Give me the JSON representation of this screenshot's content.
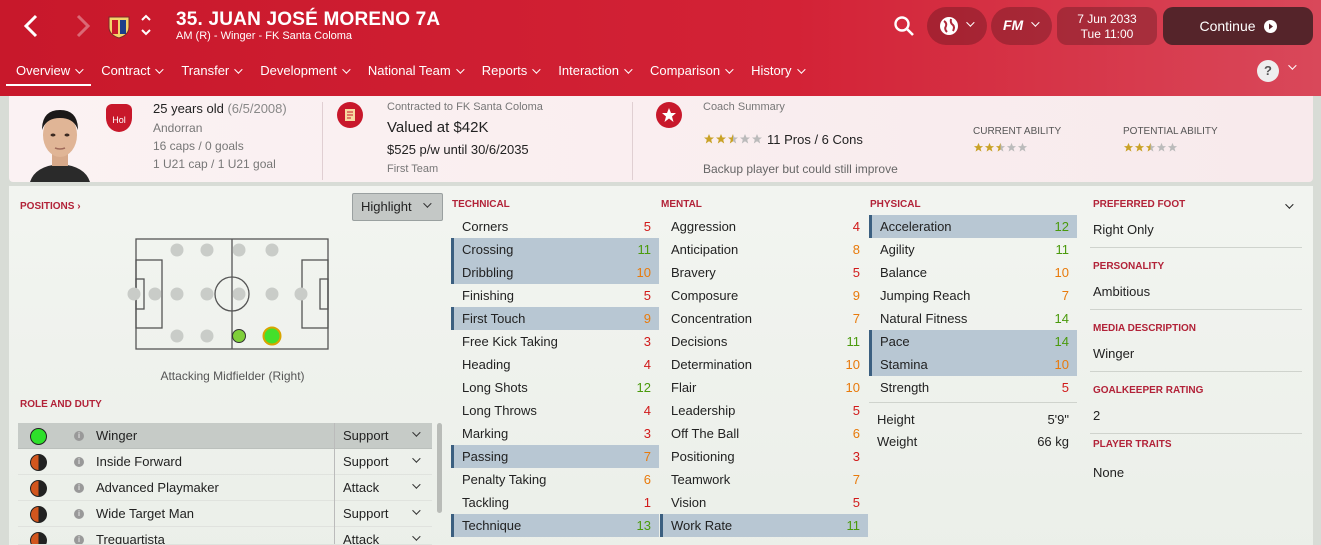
{
  "header": {
    "player_name": "35. JUAN JOSÉ MORENO 7A",
    "player_sub": "AM (R) - Winger - FK Santa Coloma",
    "date_line1": "7 Jun 2033",
    "date_line2": "Tue 11:00",
    "continue_label": "Continue",
    "fm_label": "FM"
  },
  "tabs": [
    {
      "label": "Overview"
    },
    {
      "label": "Contract"
    },
    {
      "label": "Transfer"
    },
    {
      "label": "Development"
    },
    {
      "label": "National Team"
    },
    {
      "label": "Reports"
    },
    {
      "label": "Interaction"
    },
    {
      "label": "Comparison"
    },
    {
      "label": "History"
    }
  ],
  "help_label": "?",
  "summary": {
    "age": "25 years old",
    "dob": "(6/5/2008)",
    "nationality": "Andorran",
    "caps": "16 caps / 0 goals",
    "u21": "1 U21 cap / 1 U21 goal",
    "badge": "Hol",
    "contract_header": "Contracted to FK Santa Coloma",
    "value": "Valued at $42K",
    "wage": "$525 p/w until 30/6/2035",
    "squad_status": "First Team",
    "coach_header": "Coach Summary",
    "coach_stars": 2.5,
    "pros_cons": "11 Pros / 6 Cons",
    "coach_note": "Backup player but could still improve",
    "ca_label": "CURRENT ABILITY",
    "pa_label": "POTENTIAL ABILITY",
    "ca_stars": 2.5,
    "pa_stars": 2.5
  },
  "positions": {
    "title": "POSITIONS",
    "highlight_label": "Highlight",
    "position_name": "Attacking Midfielder (Right)"
  },
  "roles": {
    "title": "ROLE AND DUTY",
    "items": [
      {
        "name": "Winger",
        "duty": "Support"
      },
      {
        "name": "Inside Forward",
        "duty": "Support"
      },
      {
        "name": "Advanced Playmaker",
        "duty": "Attack"
      },
      {
        "name": "Wide Target Man",
        "duty": "Support"
      },
      {
        "name": "Trequartista",
        "duty": "Attack"
      }
    ]
  },
  "technical": {
    "title": "TECHNICAL",
    "items": [
      {
        "name": "Corners",
        "value": "5",
        "hl": false
      },
      {
        "name": "Crossing",
        "value": "11",
        "hl": true
      },
      {
        "name": "Dribbling",
        "value": "10",
        "hl": true
      },
      {
        "name": "Finishing",
        "value": "5",
        "hl": false
      },
      {
        "name": "First Touch",
        "value": "9",
        "hl": true
      },
      {
        "name": "Free Kick Taking",
        "value": "3",
        "hl": false
      },
      {
        "name": "Heading",
        "value": "4",
        "hl": false
      },
      {
        "name": "Long Shots",
        "value": "12",
        "hl": false
      },
      {
        "name": "Long Throws",
        "value": "4",
        "hl": false
      },
      {
        "name": "Marking",
        "value": "3",
        "hl": false
      },
      {
        "name": "Passing",
        "value": "7",
        "hl": true
      },
      {
        "name": "Penalty Taking",
        "value": "6",
        "hl": false
      },
      {
        "name": "Tackling",
        "value": "1",
        "hl": false
      },
      {
        "name": "Technique",
        "value": "13",
        "hl": true
      }
    ]
  },
  "mental": {
    "title": "MENTAL",
    "items": [
      {
        "name": "Aggression",
        "value": "4",
        "hl": false
      },
      {
        "name": "Anticipation",
        "value": "8",
        "hl": false
      },
      {
        "name": "Bravery",
        "value": "5",
        "hl": false
      },
      {
        "name": "Composure",
        "value": "9",
        "hl": false
      },
      {
        "name": "Concentration",
        "value": "7",
        "hl": false
      },
      {
        "name": "Decisions",
        "value": "11",
        "hl": false
      },
      {
        "name": "Determination",
        "value": "10",
        "hl": false
      },
      {
        "name": "Flair",
        "value": "10",
        "hl": false
      },
      {
        "name": "Leadership",
        "value": "5",
        "hl": false
      },
      {
        "name": "Off The Ball",
        "value": "6",
        "hl": false
      },
      {
        "name": "Positioning",
        "value": "3",
        "hl": false
      },
      {
        "name": "Teamwork",
        "value": "7",
        "hl": false
      },
      {
        "name": "Vision",
        "value": "5",
        "hl": false
      },
      {
        "name": "Work Rate",
        "value": "11",
        "hl": true
      }
    ]
  },
  "physical": {
    "title": "PHYSICAL",
    "items": [
      {
        "name": "Acceleration",
        "value": "12",
        "hl": true
      },
      {
        "name": "Agility",
        "value": "11",
        "hl": false
      },
      {
        "name": "Balance",
        "value": "10",
        "hl": false
      },
      {
        "name": "Jumping Reach",
        "value": "7",
        "hl": false
      },
      {
        "name": "Natural Fitness",
        "value": "14",
        "hl": false
      },
      {
        "name": "Pace",
        "value": "14",
        "hl": true
      },
      {
        "name": "Stamina",
        "value": "10",
        "hl": true
      },
      {
        "name": "Strength",
        "value": "5",
        "hl": false
      }
    ],
    "height_label": "Height",
    "height_value": "5'9\"",
    "weight_label": "Weight",
    "weight_value": "66 kg"
  },
  "info_panel": {
    "foot_label": "PREFERRED FOOT",
    "foot_value": "Right Only",
    "personality_label": "PERSONALITY",
    "personality_value": "Ambitious",
    "media_label": "MEDIA DESCRIPTION",
    "media_value": "Winger",
    "gk_label": "GOALKEEPER RATING",
    "gk_value": "2",
    "traits_label": "PLAYER TRAITS",
    "traits_value": "None"
  },
  "colors": {
    "header_red": "#c8182b",
    "attr_low": "#d11a1a",
    "attr_mid": "#e87a0b",
    "attr_high": "#4a9a0c",
    "highlight_row": "#b8c7d3"
  }
}
